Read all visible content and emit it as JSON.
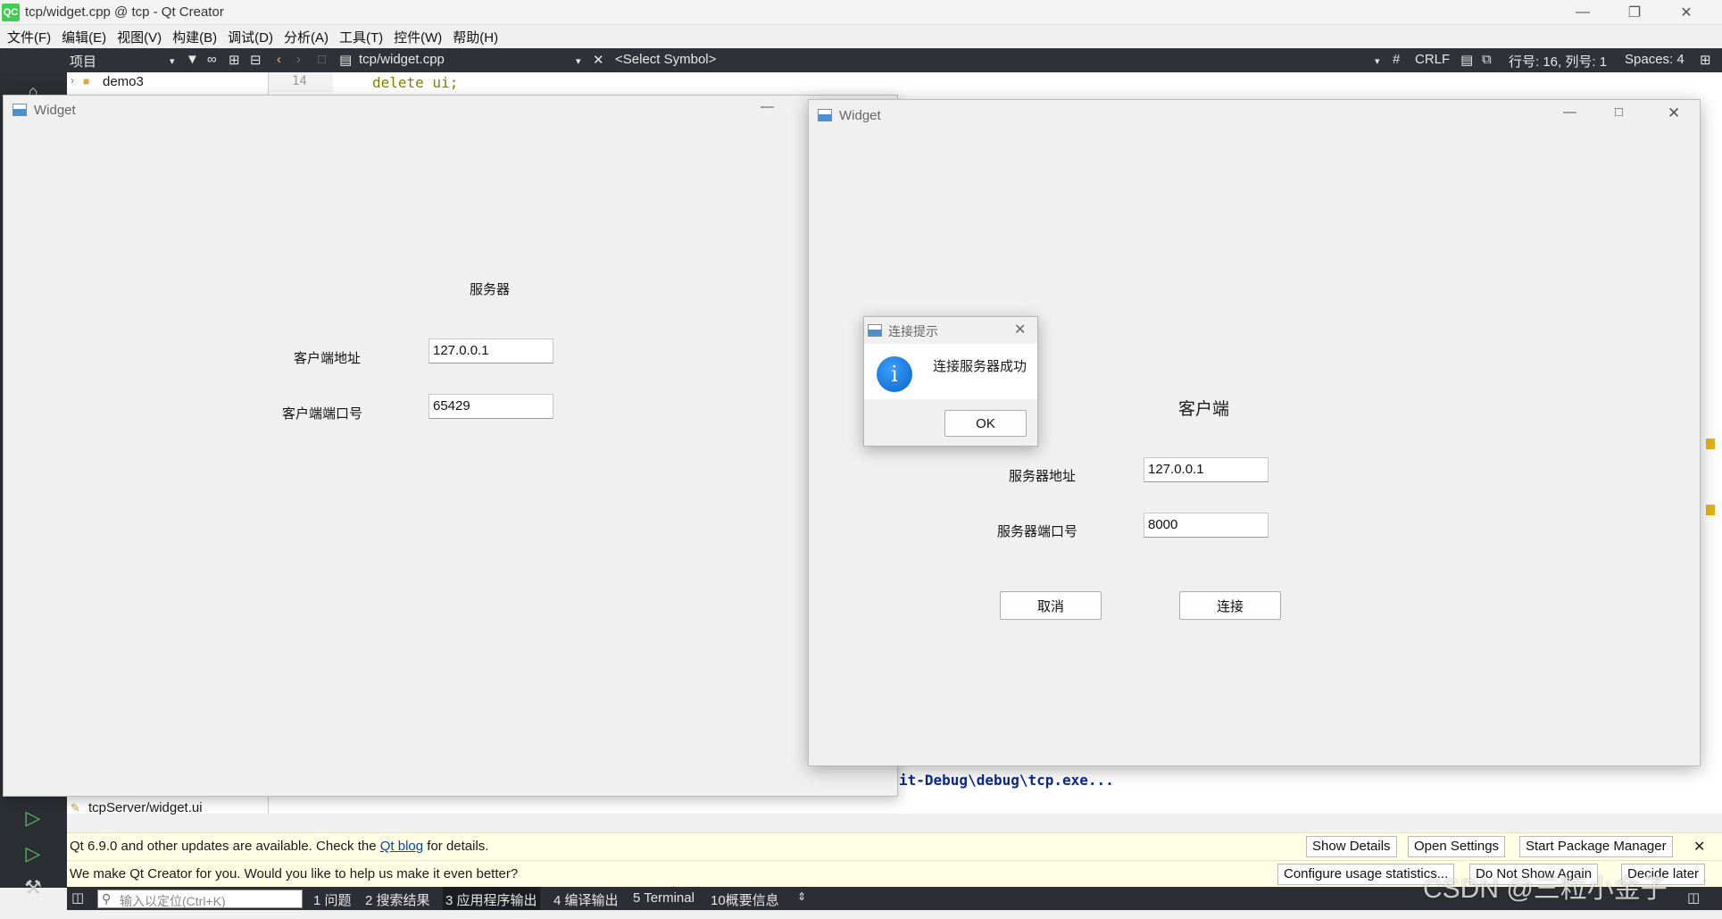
{
  "app": {
    "title": "tcp/widget.cpp @ tcp - Qt Creator",
    "logo": "QC"
  },
  "menu": [
    "文件(F)",
    "编辑(E)",
    "视图(V)",
    "构建(B)",
    "调试(D)",
    "分析(A)",
    "工具(T)",
    "控件(W)",
    "帮助(H)"
  ],
  "toolbar": {
    "project_label": "项目",
    "file_tab": "tcp/widget.cpp",
    "symbol": "<Select Symbol>",
    "hash": "#",
    "line_ending": "CRLF",
    "position": "行号: 16, 列号: 1",
    "spaces": "Spaces: 4"
  },
  "tree": {
    "item_top": "demo3",
    "item_bottom": "tcpServer/widget.ui"
  },
  "editor": {
    "line_number": "14",
    "code": "delete ui;",
    "output_text": "it-Debug\\debug\\tcp.exe..."
  },
  "server_window": {
    "title": "Widget",
    "heading": "服务器",
    "addr_label": "客户端地址",
    "addr_value": "127.0.0.1",
    "port_label": "客户端端口号",
    "port_value": "65429"
  },
  "client_window": {
    "title": "Widget",
    "heading": "客户端",
    "addr_label": "服务器地址",
    "addr_value": "127.0.0.1",
    "port_label": "服务器端口号",
    "port_value": "8000",
    "cancel_label": "取消",
    "connect_label": "连接"
  },
  "dialog": {
    "title": "连接提示",
    "message": "连接服务器成功",
    "ok_label": "OK"
  },
  "infobar_update": {
    "text_before": "Qt 6.9.0 and other updates are available. Check the ",
    "link": "Qt blog",
    "text_after": " for details.",
    "btn_details": "Show Details",
    "btn_settings": "Open Settings",
    "btn_pkg": "Start Package Manager"
  },
  "infobar_usage": {
    "text": "We make Qt Creator for you. Would you like to help us make it even better?",
    "btn_configure": "Configure usage statistics...",
    "btn_dont": "Do Not Show Again",
    "btn_later": "Decide later"
  },
  "statusbar": {
    "locate_placeholder": "输入以定位(Ctrl+K)",
    "tabs": [
      "1 问题",
      "2 搜索结果",
      "3 应用程序输出",
      "4 编译输出",
      "5 Terminal",
      "10概要信息"
    ]
  },
  "watermark": "CSDN @三粒小金子",
  "colors": {
    "accent_green": "#41cd52",
    "dark_panel": "#2f3238",
    "info_bar": "#ffffe6",
    "link_blue": "#0645ad"
  }
}
